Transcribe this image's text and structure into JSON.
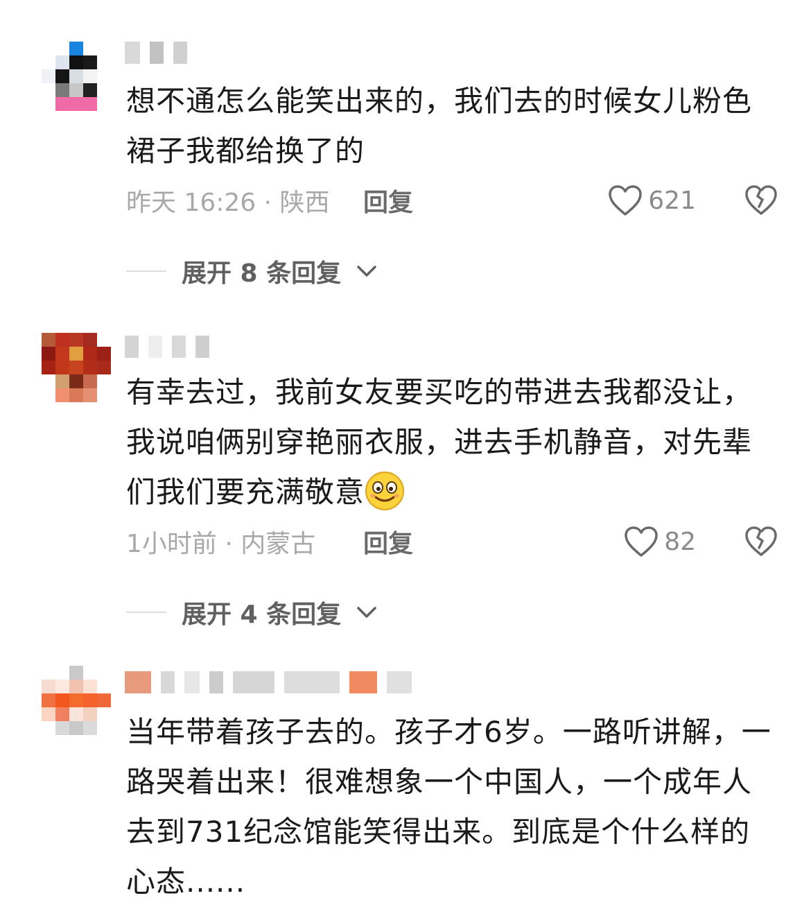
{
  "comments": [
    {
      "text": "想不通怎么能笑出来的，我们去的时候女儿粉色裙子我都给换了的",
      "time_location": "昨天 16:26 · 陕西",
      "reply_label": "回复",
      "likes": "621",
      "expand_label": "展开 8 条回复"
    },
    {
      "text": "有幸去过，我前女友要买吃的带进去我都没让，我说咱俩别穿艳丽衣服，进去手机静音，对先辈们我们要充满敬意",
      "emoji": "smile-emoji",
      "time_location": "1小时前 · 内蒙古",
      "reply_label": "回复",
      "likes": "82",
      "expand_label": "展开 4 条回复"
    },
    {
      "text": "当年带着孩子去的。孩子才6岁。一路听讲解，一路哭着出来！很难想象一个中国人，一个成年人去到731纪念馆能笑得出来。到底是个什么样的心态......"
    }
  ],
  "icons": {
    "like": "heart-outline-icon",
    "dislike": "broken-heart-icon",
    "expand": "chevron-down-icon"
  },
  "colors": {
    "text": "#1a1a1a",
    "meta": "#a8a8a8",
    "reply": "#6a6a6a",
    "expand": "#606060"
  }
}
